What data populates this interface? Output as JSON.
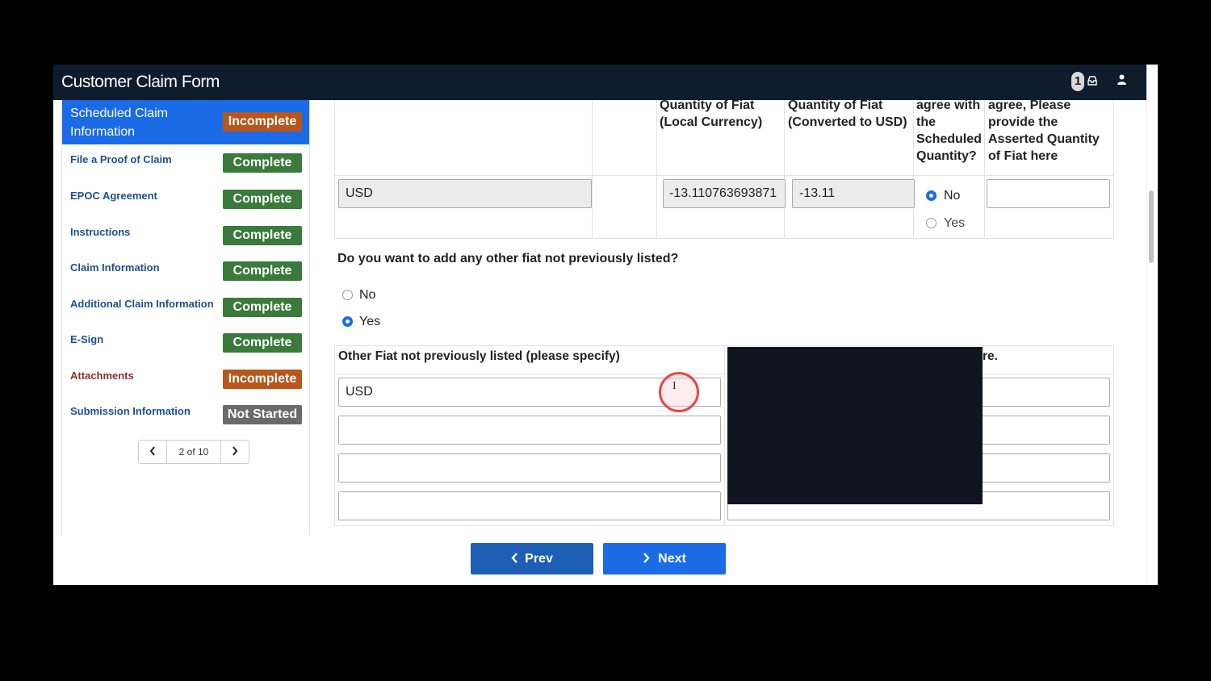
{
  "app": {
    "title": "Customer Claim Form",
    "notification_count": "1"
  },
  "sidebar": {
    "items": [
      {
        "label": "Scheduled Claim Information",
        "status": "Incomplete",
        "status_type": "incomplete",
        "active": true
      },
      {
        "label": "File a Proof of Claim",
        "status": "Complete",
        "status_type": "complete"
      },
      {
        "label": "EPOC Agreement",
        "status": "Complete",
        "status_type": "complete"
      },
      {
        "label": "Instructions",
        "status": "Complete",
        "status_type": "complete"
      },
      {
        "label": "Claim Information",
        "status": "Complete",
        "status_type": "complete"
      },
      {
        "label": "Additional Claim Information",
        "status": "Complete",
        "status_type": "complete"
      },
      {
        "label": "E-Sign",
        "status": "Complete",
        "status_type": "complete"
      },
      {
        "label": "Attachments",
        "status": "Incomplete",
        "status_type": "incomplete"
      },
      {
        "label": "Submission Information",
        "status": "Not Started",
        "status_type": "notstarted"
      }
    ],
    "pager": {
      "text": "2 of 10"
    }
  },
  "fiat_table": {
    "headers": {
      "local": "Quantity of Fiat (Local Currency)",
      "usd": "Quantity of Fiat (Converted to USD)",
      "agree": "agree with the Scheduled Quantity?",
      "assert": "agree, Please provide the Asserted Quantity of Fiat here"
    },
    "row": {
      "currency": "USD",
      "local_qty": "-13.110763693871",
      "usd_qty": "-13.11",
      "agree_options": [
        "No",
        "Yes"
      ],
      "agree_selected": "No",
      "asserted": ""
    }
  },
  "other_fiat": {
    "question": "Do you want to add any other fiat not previously listed?",
    "options": [
      "No",
      "Yes"
    ],
    "selected": "Yes",
    "col1_header": "Other Fiat not previously listed (please specify)",
    "col2_header_visible": "re.",
    "rows": [
      "USD",
      "",
      "",
      ""
    ]
  },
  "footer": {
    "prev_label": "Prev",
    "next_label": "Next"
  },
  "colors": {
    "topbar": "#0f1c2e",
    "accent": "#1b6be6",
    "complete": "#3a7a3a",
    "incomplete": "#b8561c",
    "not_started": "#6a6a6a"
  }
}
